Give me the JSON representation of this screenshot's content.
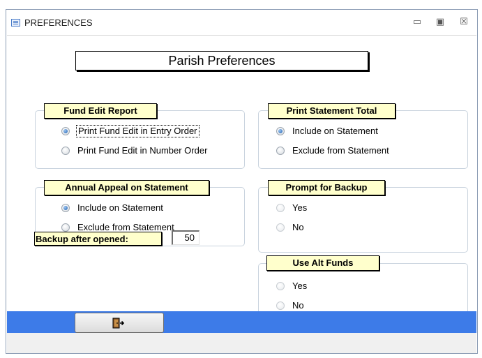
{
  "window": {
    "title": "PREFERENCES",
    "minimize": "▭",
    "restore": "▣",
    "close": "☒"
  },
  "header": {
    "title": "Parish Preferences"
  },
  "fund_edit_report": {
    "label": "Fund Edit Report",
    "options": [
      {
        "label": "Print Fund Edit in Entry Order",
        "checked": true
      },
      {
        "label": "Print Fund Edit in Number Order",
        "checked": false
      }
    ]
  },
  "print_statement_total": {
    "label": "Print Statement Total",
    "options": [
      {
        "label": "Include on Statement",
        "checked": true
      },
      {
        "label": "Exclude from Statement",
        "checked": false
      }
    ]
  },
  "annual_appeal": {
    "label": "Annual Appeal on Statement",
    "options": [
      {
        "label": "Include on Statement",
        "checked": true
      },
      {
        "label": "Exclude from Statement",
        "checked": false
      }
    ]
  },
  "prompt_backup": {
    "label": "Prompt for Backup",
    "options": [
      {
        "label": "Yes",
        "checked": false
      },
      {
        "label": "No",
        "checked": false
      }
    ]
  },
  "backup_after": {
    "label": "Backup after opened:",
    "value": "50"
  },
  "use_alt_funds": {
    "label": "Use Alt Funds",
    "options": [
      {
        "label": "Yes",
        "checked": false
      },
      {
        "label": "No",
        "checked": false
      }
    ]
  },
  "colors": {
    "footer": "#3d7be8",
    "label_bg": "#ffffcc",
    "radio_checked": "#1c5fb0"
  },
  "icons": {
    "app": "form-icon",
    "exit": "exit-door-icon"
  }
}
